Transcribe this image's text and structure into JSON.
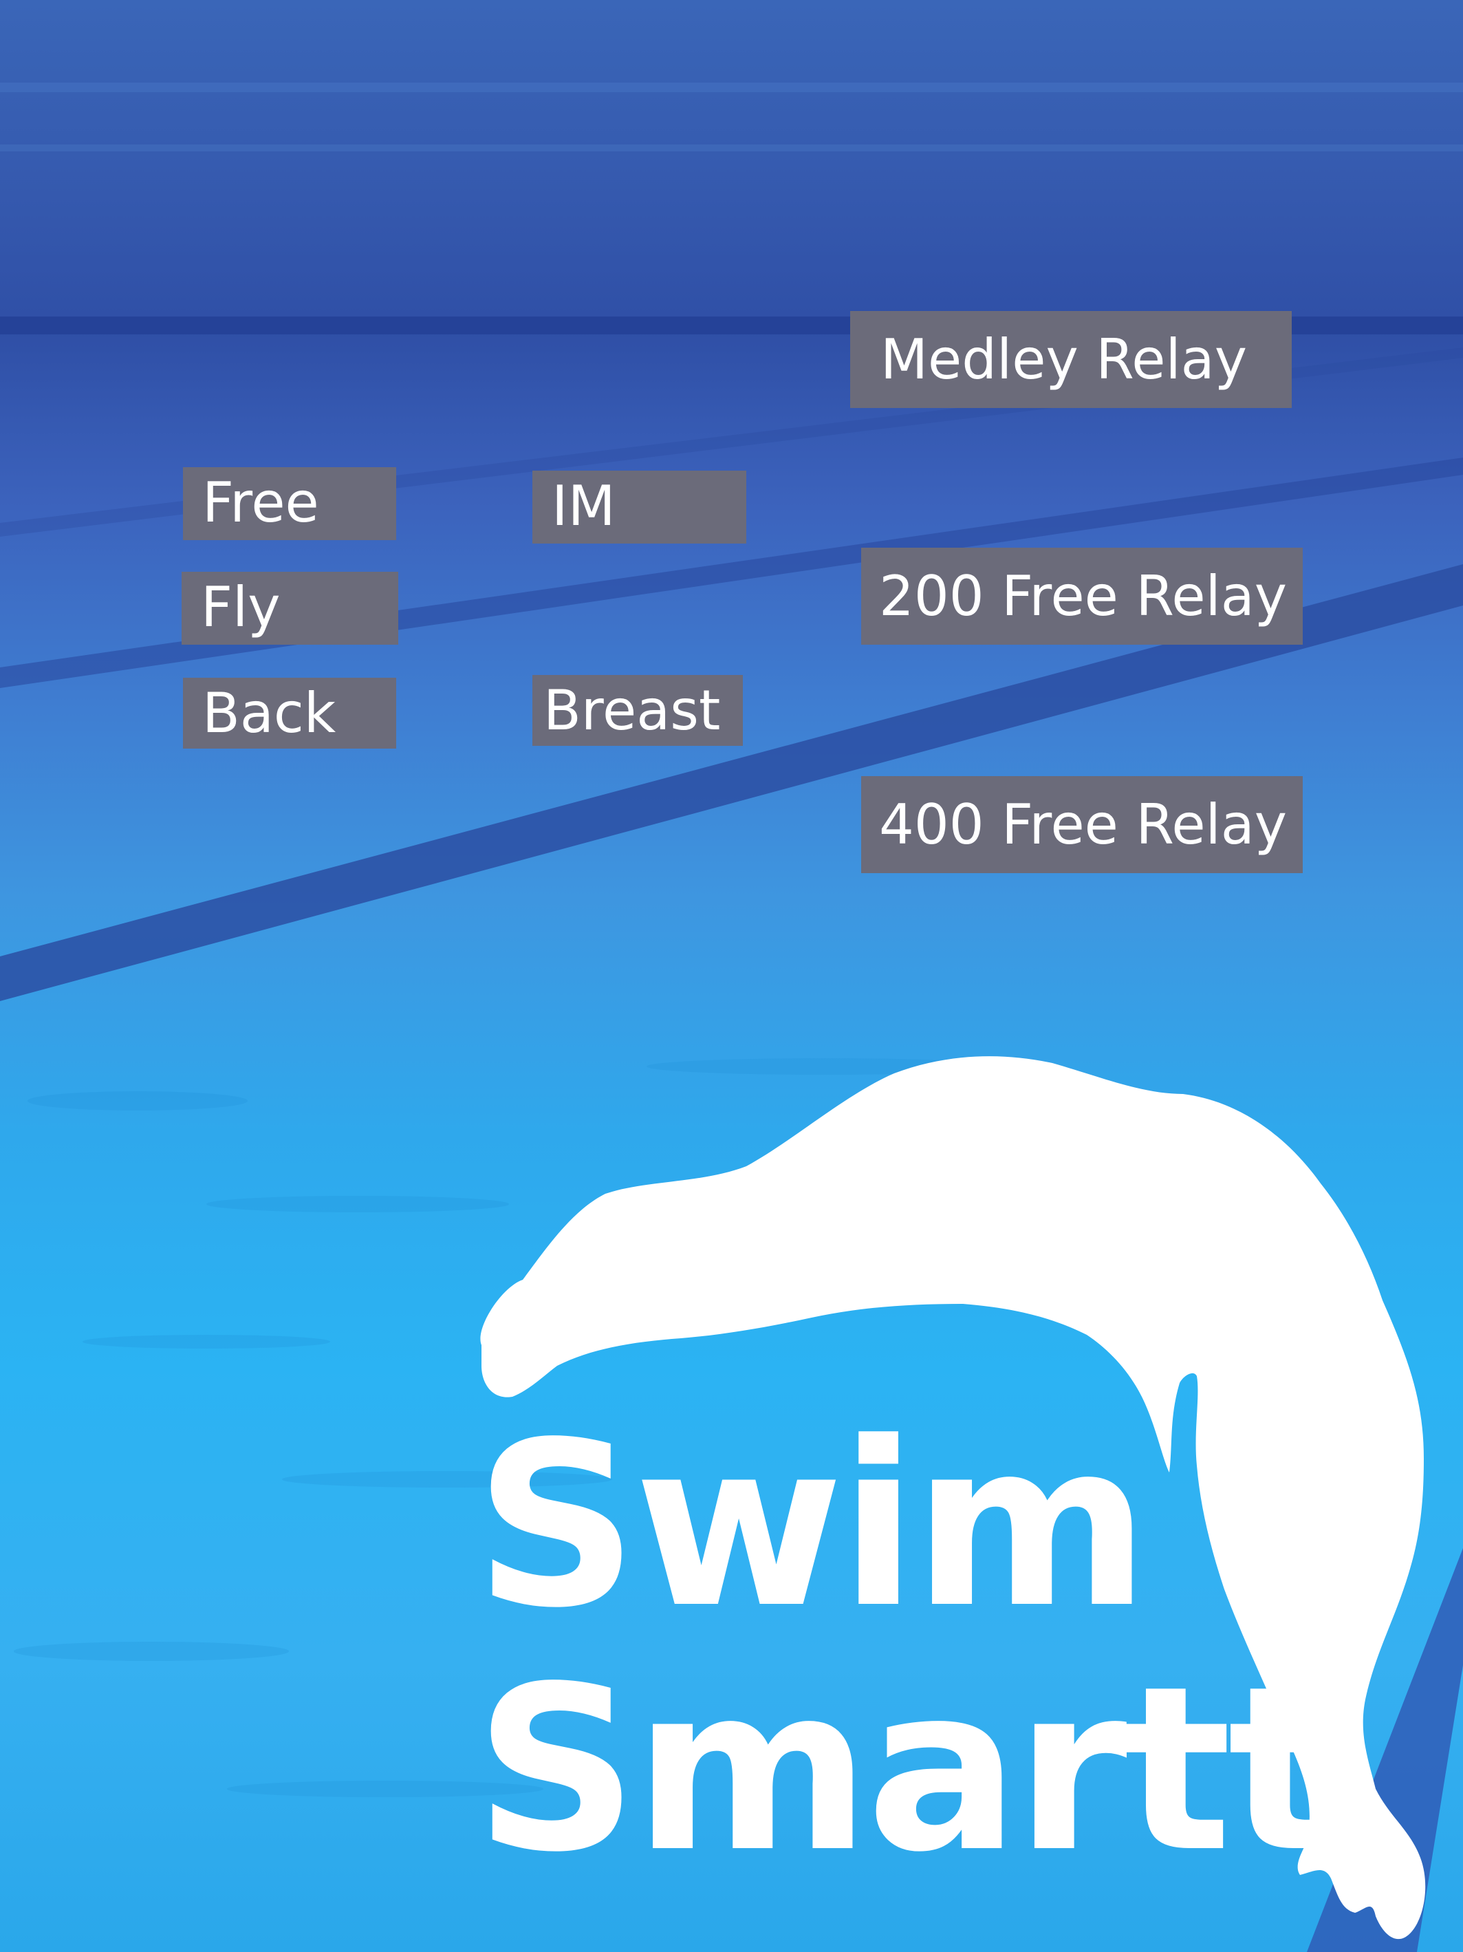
{
  "events": {
    "free": "Free",
    "fly": "Fly",
    "back": "Back",
    "im": "IM",
    "breast": "Breast",
    "medley_relay": "Medley Relay",
    "free_relay_200": "200 Free Relay",
    "free_relay_400": "400 Free Relay"
  },
  "brand": {
    "line1": "Swim",
    "line2": "Smartt"
  },
  "colors": {
    "button": "#6b6b7a",
    "water_light": "#2bb3f3",
    "water_dark": "#2f4fa6",
    "text": "#ffffff"
  },
  "icons": {
    "swimmer": "diving-swimmer-silhouette"
  }
}
